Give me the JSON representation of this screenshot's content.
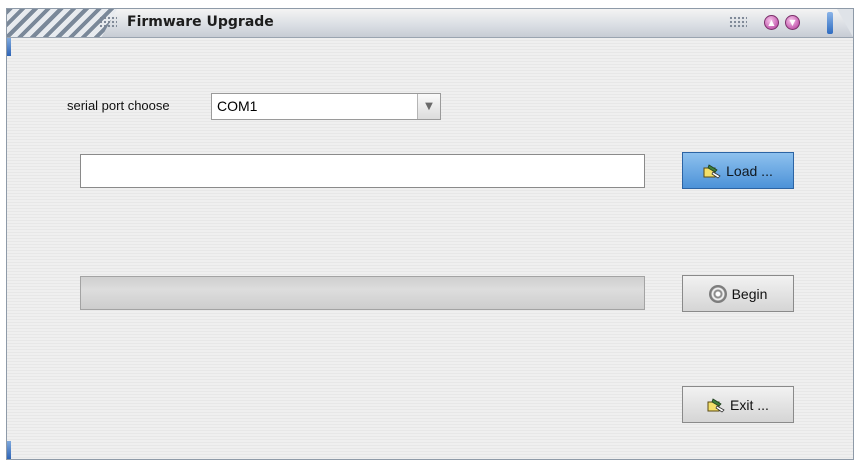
{
  "window": {
    "title": "Firmware Upgrade"
  },
  "title_buttons": {
    "minimize_icon": "circle-up-arrow",
    "close_icon": "circle-down-arrow"
  },
  "serial_port": {
    "label": "serial port choose",
    "selected": "COM1",
    "dropdown_icon": "chevron-down"
  },
  "file_path": {
    "value": ""
  },
  "progress": {
    "value": 0
  },
  "buttons": {
    "load_label": "Load ...",
    "begin_label": "Begin",
    "exit_label": "Exit ..."
  },
  "colors": {
    "active_button": "#4c92d8",
    "title_button": "#c65fb1"
  }
}
